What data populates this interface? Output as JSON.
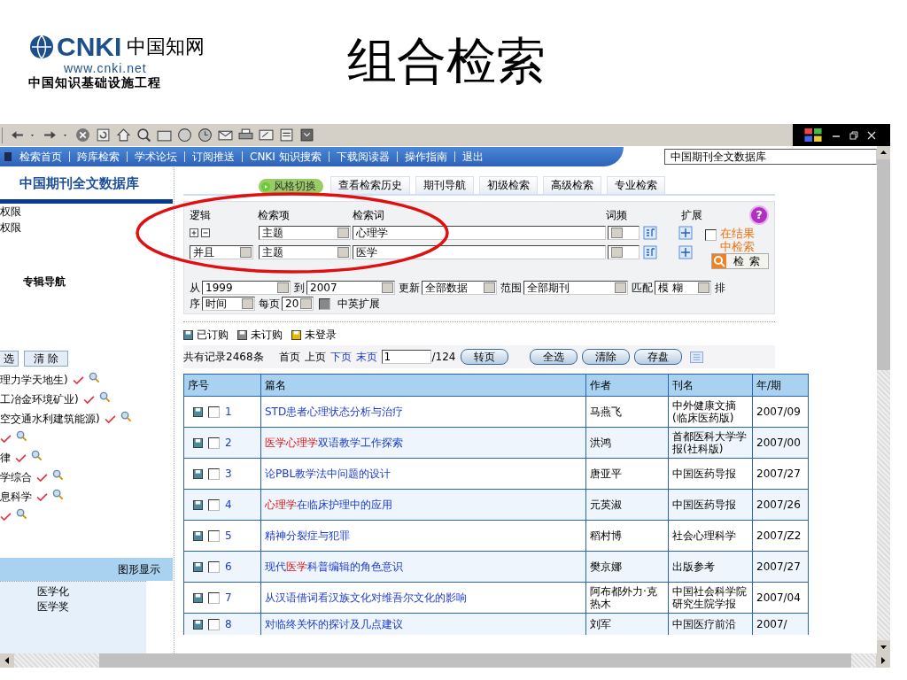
{
  "slide": {
    "title": "组合检索",
    "logo": {
      "brand": "CNKI",
      "chinese": "中国知网",
      "url": "www.cnki.net",
      "tagline": "中国知识基础设施工程"
    }
  },
  "nav": {
    "links": [
      "检索首页",
      "跨库检索",
      "学术论坛",
      "订阅推送",
      "CNKI 知识搜索",
      "下载阅读器",
      "操作指南",
      "退出"
    ],
    "database": "中国期刊全文数据库"
  },
  "sidebar": {
    "title": "中国期刊全文数据库",
    "items": [
      "权限",
      "权限"
    ],
    "nav_title": "专辑导航",
    "buttons": [
      "选",
      "清 除"
    ],
    "categories": [
      {
        "kind": "text",
        "label": "理力学天地生)"
      },
      {
        "kind": "text",
        "label": "工冶金环境矿业)"
      },
      {
        "kind": "text",
        "label": "空交通水利建筑能源)"
      },
      {
        "kind": "icons"
      },
      {
        "kind": "text",
        "label": "律"
      },
      {
        "kind": "text",
        "label": "学综合"
      },
      {
        "kind": "text",
        "label": "息科学"
      },
      {
        "kind": "icons"
      }
    ],
    "graph": {
      "title": "图形显示",
      "items": [
        "医学化",
        "医学奖"
      ]
    }
  },
  "tabs": [
    {
      "kind": "toggle",
      "label": "风格切换"
    },
    {
      "kind": "tab",
      "label": "查看检索历史"
    },
    {
      "kind": "tab",
      "label": "期刊导航"
    },
    {
      "kind": "tab",
      "label": "初级检索"
    },
    {
      "kind": "tab",
      "label": "高级检索"
    },
    {
      "kind": "tab",
      "label": "专业检索"
    }
  ],
  "search": {
    "headers": {
      "logic": "逻辑",
      "field": "检索项",
      "term": "检索词",
      "freq": "词频",
      "expand": "扩展"
    },
    "rows": [
      {
        "kind": "first",
        "field": "主题",
        "term": "心理学"
      },
      {
        "kind": "logic",
        "logic": "并且",
        "field": "主题",
        "term": "医学"
      }
    ],
    "in_results": {
      "label": "在结果中检索",
      "checked": false
    },
    "button": "检 索",
    "help": "?"
  },
  "filters": {
    "from_label": "从",
    "from": "1999",
    "to_label": "到",
    "to": "2007",
    "update_label": "更新",
    "update": "全部数据",
    "range_label": "范围",
    "range": "全部期刊",
    "match_label": "匹配",
    "match": "模 糊",
    "sort_label_a": "排",
    "sort_label_b": "序",
    "sort": "时间",
    "per_page_label": "每页",
    "per_page": "20",
    "bilingual": {
      "label": "中英扩展",
      "checked": false
    }
  },
  "legend": [
    {
      "label": "已订购",
      "color": "#4a8a9a"
    },
    {
      "label": "未订购",
      "color": "#8a8a8a"
    },
    {
      "label": "未登录",
      "color": "#e8b800"
    }
  ],
  "paging": {
    "total": "共有记录2468条",
    "links": [
      {
        "label": "首页",
        "disabled": true
      },
      {
        "label": "上页",
        "disabled": true
      },
      {
        "label": "下页",
        "disabled": false
      },
      {
        "label": "末页",
        "disabled": false
      }
    ],
    "page": "1",
    "pages": "/124",
    "go": "转页",
    "actions": [
      "全选",
      "清除",
      "存盘"
    ]
  },
  "table": {
    "columns": [
      "序号",
      "篇名",
      "作者",
      "刊名",
      "年/期"
    ],
    "rows": [
      {
        "no": "1",
        "checked": false,
        "title": [
          {
            "text": "STD患者心理状态分析与治疗",
            "hit": false
          }
        ],
        "author": "马燕飞",
        "journal": "中外健康文摘(临床医药版)",
        "issue": "2007/09"
      },
      {
        "no": "2",
        "checked": false,
        "title": [
          {
            "text": "医学心理学",
            "hit": true
          },
          {
            "text": "双语教学工作探索",
            "hit": false
          }
        ],
        "author": "洪鸿",
        "journal": "首都医科大学学报(社科版)",
        "issue": "2007/00"
      },
      {
        "no": "3",
        "checked": false,
        "title": [
          {
            "text": "论PBL教学法中问题的设计",
            "hit": false
          }
        ],
        "author": "唐亚平",
        "journal": "中国医药导报",
        "issue": "2007/27"
      },
      {
        "no": "4",
        "checked": false,
        "title": [
          {
            "text": "心理学",
            "hit": true
          },
          {
            "text": "在临床护理中的应用",
            "hit": false
          }
        ],
        "author": "元英淑",
        "journal": "中国医药导报",
        "issue": "2007/26"
      },
      {
        "no": "5",
        "checked": false,
        "title": [
          {
            "text": "精神分裂症与犯罪",
            "hit": false
          }
        ],
        "author": "稻村博",
        "journal": "社会心理科学",
        "issue": "2007/Z2"
      },
      {
        "no": "6",
        "checked": false,
        "title": [
          {
            "text": "现代",
            "hit": false
          },
          {
            "text": "医学",
            "hit": true
          },
          {
            "text": "科普编辑的角色意识",
            "hit": false
          }
        ],
        "author": "樊京娜",
        "journal": "出版参考",
        "issue": "2007/27"
      },
      {
        "no": "7",
        "checked": false,
        "title": [
          {
            "text": "从汉语借词看汉族文化对维吾尔文化的影响",
            "hit": false
          }
        ],
        "author": "阿布都外力·克热木",
        "journal": "中国社会科学院研究生院学报",
        "issue": "2007/04"
      },
      {
        "no": "8",
        "checked": false,
        "title": [
          {
            "text": "对临终关怀的探讨及几点建议",
            "hit": false
          }
        ],
        "author": "刘军",
        "journal": "中国医疗前沿",
        "issue": "2007/"
      }
    ]
  }
}
